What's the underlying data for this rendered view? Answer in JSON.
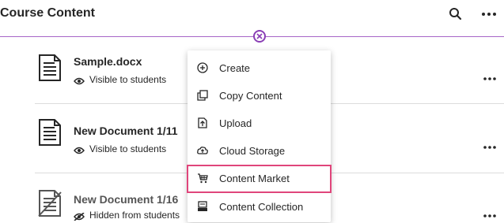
{
  "header": {
    "title": "Course Content",
    "search_icon": "search-icon",
    "more_icon": "more-options-icon"
  },
  "colors": {
    "accent_purple": "#8a3fb5",
    "highlight_pink": "#e0457b",
    "divider": "#dcdcdc"
  },
  "items": [
    {
      "title": "Sample.docx",
      "status": "Visible to students",
      "status_icon": "eye-icon",
      "doc_icon": "document-icon"
    },
    {
      "title": "New Document 1/11",
      "status": "Visible to students",
      "status_icon": "eye-icon",
      "doc_icon": "document-icon"
    },
    {
      "title": "New Document 1/16",
      "status": "Hidden from students",
      "status_icon": "eye-slash-icon",
      "doc_icon": "document-hidden-icon"
    }
  ],
  "menu": {
    "items": [
      {
        "label": "Create",
        "icon": "plus-circle-icon"
      },
      {
        "label": "Copy Content",
        "icon": "copy-icon"
      },
      {
        "label": "Upload",
        "icon": "upload-icon"
      },
      {
        "label": "Cloud Storage",
        "icon": "cloud-icon"
      },
      {
        "label": "Content Market",
        "icon": "market-icon",
        "highlighted": true
      },
      {
        "label": "Content Collection",
        "icon": "collection-icon"
      }
    ]
  }
}
